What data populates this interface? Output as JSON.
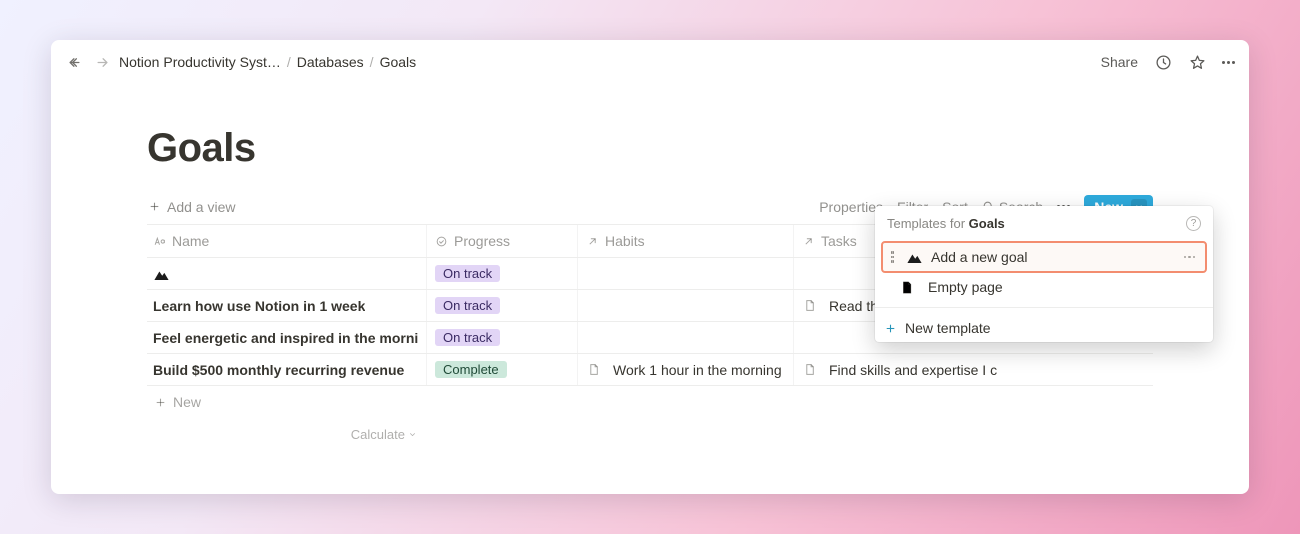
{
  "breadcrumb": {
    "items": [
      "Notion Productivity Syst…",
      "Databases",
      "Goals"
    ]
  },
  "topbar": {
    "share": "Share"
  },
  "page": {
    "title": "Goals"
  },
  "viewbar": {
    "add_view": "Add a view",
    "properties": "Properties",
    "filter": "Filter",
    "sort": "Sort",
    "search": "Search",
    "new_button": "New"
  },
  "columns": {
    "name": "Name",
    "progress": "Progress",
    "habits": "Habits",
    "tasks": "Tasks"
  },
  "rows": [
    {
      "name": "",
      "icon_only": true,
      "progress": "On track",
      "progress_variant": "on-track",
      "habits": [],
      "tasks": []
    },
    {
      "name": "Learn how use Notion in 1 week",
      "progress": "On track",
      "progress_variant": "on-track",
      "habits": [],
      "tasks": [
        "Read the tutori"
      ]
    },
    {
      "name": "Feel energetic and inspired in the morning",
      "progress": "On track",
      "progress_variant": "on-track",
      "habits": [],
      "tasks": []
    },
    {
      "name": "Build $500 monthly recurring revenue",
      "progress": "Complete",
      "progress_variant": "complete",
      "habits": [
        "Work 1 hour in the morning"
      ],
      "tasks": [
        "Find skills and expertise I c"
      ]
    }
  ],
  "footer": {
    "new_row": "New",
    "calculate": "Calculate"
  },
  "popover": {
    "heading_prefix": "Templates for ",
    "heading_subject": "Goals",
    "template_item": "Add a new goal",
    "empty_page": "Empty page",
    "new_template": "New template"
  }
}
